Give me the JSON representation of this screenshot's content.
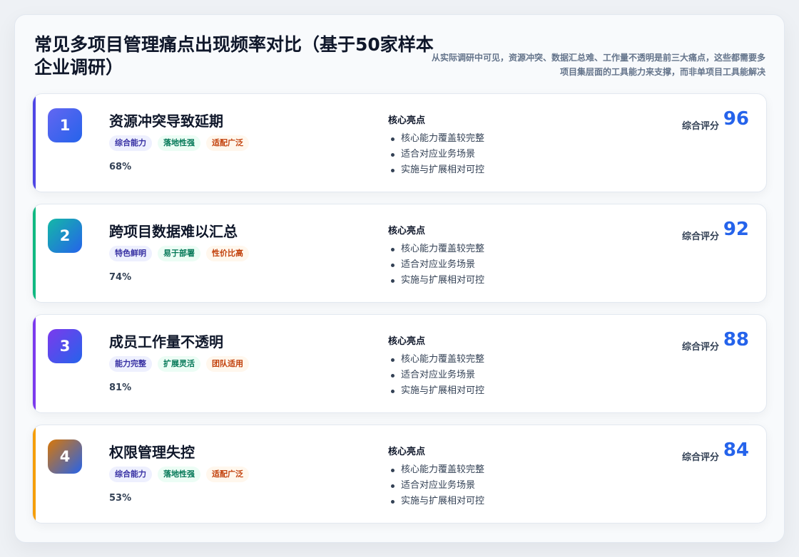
{
  "header": {
    "title": "常见多项目管理痛点出现频率对比（基于50家样本企业调研）",
    "subtitle": "从实际调研中可见，资源冲突、数据汇总难、工作量不透明是前三大痛点，这些都需要多项目集层面的工具能力来支撑，而非单项目工具能解决"
  },
  "colors": {
    "accent_1": "#4f46e5",
    "accent_2": "#10b981",
    "accent_3": "#7c3aed",
    "accent_4": "#f59e0b",
    "score": "#2563eb"
  },
  "cards": [
    {
      "rank": "1",
      "title": "资源冲突导致延期",
      "tags": [
        "综合能力",
        "落地性强",
        "适配广泛"
      ],
      "percent": "68%",
      "highlights_title": "核心亮点",
      "highlights": [
        "核心能力覆盖较完整",
        "适合对应业务场景",
        "实施与扩展相对可控"
      ],
      "score_label": "综合评分",
      "score": "96"
    },
    {
      "rank": "2",
      "title": "跨项目数据难以汇总",
      "tags": [
        "特色鲜明",
        "易于部署",
        "性价比高"
      ],
      "percent": "74%",
      "highlights_title": "核心亮点",
      "highlights": [
        "核心能力覆盖较完整",
        "适合对应业务场景",
        "实施与扩展相对可控"
      ],
      "score_label": "综合评分",
      "score": "92"
    },
    {
      "rank": "3",
      "title": "成员工作量不透明",
      "tags": [
        "能力完整",
        "扩展灵活",
        "团队适用"
      ],
      "percent": "81%",
      "highlights_title": "核心亮点",
      "highlights": [
        "核心能力覆盖较完整",
        "适合对应业务场景",
        "实施与扩展相对可控"
      ],
      "score_label": "综合评分",
      "score": "88"
    },
    {
      "rank": "4",
      "title": "权限管理失控",
      "tags": [
        "综合能力",
        "落地性强",
        "适配广泛"
      ],
      "percent": "53%",
      "highlights_title": "核心亮点",
      "highlights": [
        "核心能力覆盖较完整",
        "适合对应业务场景",
        "实施与扩展相对可控"
      ],
      "score_label": "综合评分",
      "score": "84"
    }
  ]
}
